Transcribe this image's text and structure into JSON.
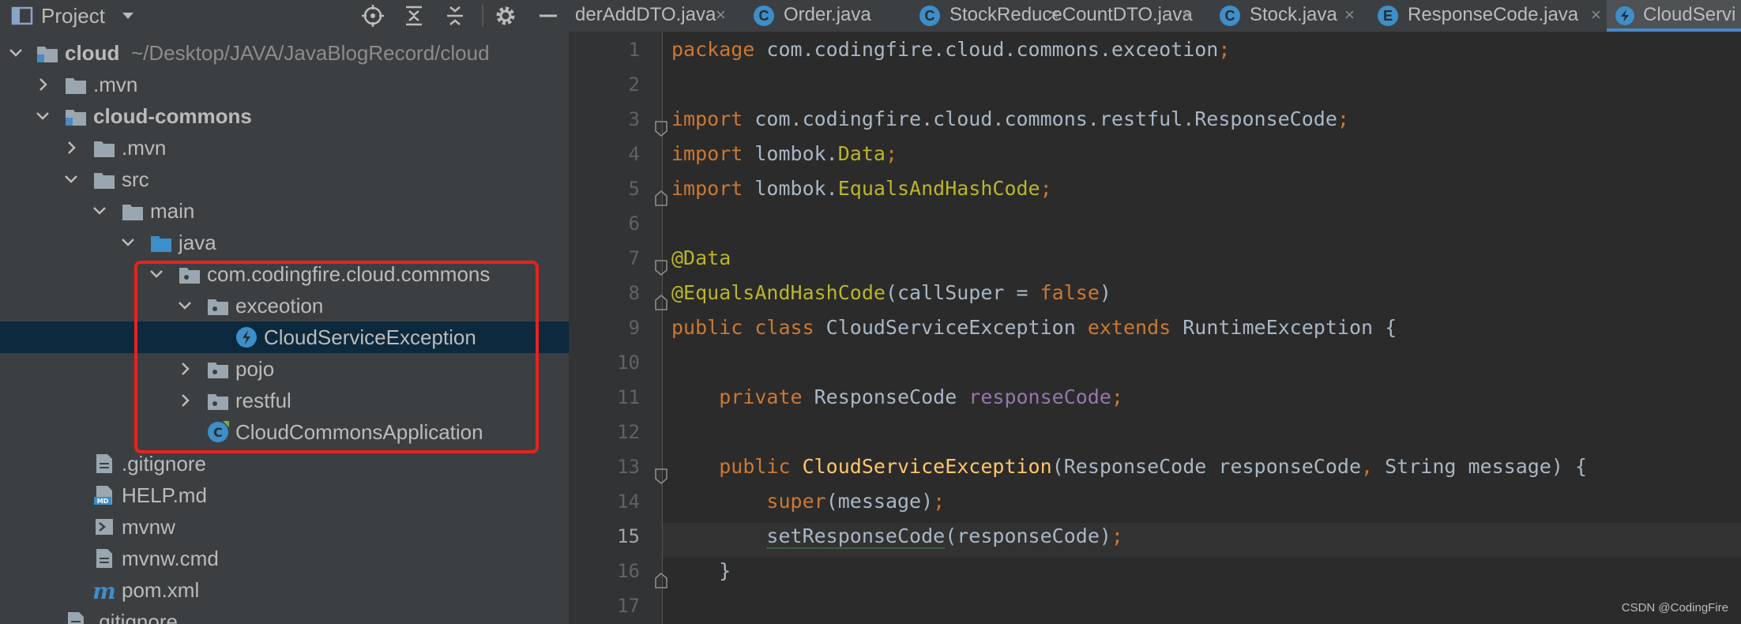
{
  "project_panel": {
    "title": "Project",
    "tree": [
      {
        "label": "cloud",
        "path": "~/Desktop/JAVA/JavaBlogRecord/cloud",
        "bold": true
      },
      {
        "label": ".mvn"
      },
      {
        "label": "cloud-commons",
        "bold": true
      },
      {
        "label": ".mvn"
      },
      {
        "label": "src"
      },
      {
        "label": "main"
      },
      {
        "label": "java"
      },
      {
        "label": "com.codingfire.cloud.commons"
      },
      {
        "label": "exceotion"
      },
      {
        "label": "CloudServiceException"
      },
      {
        "label": "pojo"
      },
      {
        "label": "restful"
      },
      {
        "label": "CloudCommonsApplication"
      },
      {
        "label": ".gitignore"
      },
      {
        "label": "HELP.md"
      },
      {
        "label": "mvnw"
      },
      {
        "label": "mvnw.cmd"
      },
      {
        "label": "pom.xml"
      },
      {
        "label": ".gitignore"
      }
    ]
  },
  "tabs": [
    {
      "label": "derAddDTO.java",
      "icon": ""
    },
    {
      "label": "Order.java",
      "icon": "C"
    },
    {
      "label": "StockReduceCountDTO.java",
      "icon": "C"
    },
    {
      "label": "Stock.java",
      "icon": "C"
    },
    {
      "label": "ResponseCode.java",
      "icon": "E"
    },
    {
      "label": "CloudServi",
      "icon": "exception",
      "active": true
    }
  ],
  "tab_close_glyph": "×",
  "editor": {
    "current_line": "15",
    "line_numbers": [
      "1",
      "2",
      "3",
      "4",
      "5",
      "6",
      "7",
      "8",
      "9",
      "10",
      "11",
      "12",
      "13",
      "14",
      "15",
      "16",
      "17"
    ],
    "code": {
      "l1_kw": "package",
      "l1_rest": " com.codingfire.cloud.commons.exceotion",
      "l1_semi": ";",
      "l3_kw": "import",
      "l3_rest": " com.codingfire.cloud.commons.restful.ResponseCode",
      "l3_semi": ";",
      "l4_kw": "import",
      "l4_pre": " lombok.",
      "l4_cls": "Data",
      "l4_semi": ";",
      "l5_kw": "import",
      "l5_pre": " lombok.",
      "l5_cls": "EqualsAndHashCode",
      "l5_semi": ";",
      "l7_ann": "@Data",
      "l8_ann": "@EqualsAndHashCode",
      "l8_open": "(callSuper = ",
      "l8_kw": "false",
      "l8_close": ")",
      "l9_kw1": "public",
      "l9_kw2": " class",
      "l9_name": " CloudServiceException ",
      "l9_kw3": "extends",
      "l9_rest": " RuntimeException {",
      "l11_indent": "    ",
      "l11_kw": "private",
      "l11_type": " ResponseCode ",
      "l11_field": "responseCode",
      "l11_semi": ";",
      "l13_indent": "    ",
      "l13_kw": "public",
      "l13_fn": " CloudServiceException",
      "l13_args1": "(ResponseCode responseCode",
      "l13_comma": ",",
      "l13_args2": " String message) {",
      "l14_indent": "        ",
      "l14_kw": "super",
      "l14_rest": "(message)",
      "l14_semi": ";",
      "l15_indent": "        ",
      "l15_call": "setResponseCode",
      "l15_rest": "(responseCode)",
      "l15_semi": ";",
      "l16_indent": "    ",
      "l16_brace": "}"
    }
  },
  "watermark": "CSDN @CodingFire",
  "colors": {
    "panel_bg": "#3c3f41",
    "editor_bg": "#2b2b2b",
    "selection": "#0d293e",
    "highlight_box": "#e8221f",
    "keyword": "#cc7832",
    "annotation": "#bbb529"
  }
}
